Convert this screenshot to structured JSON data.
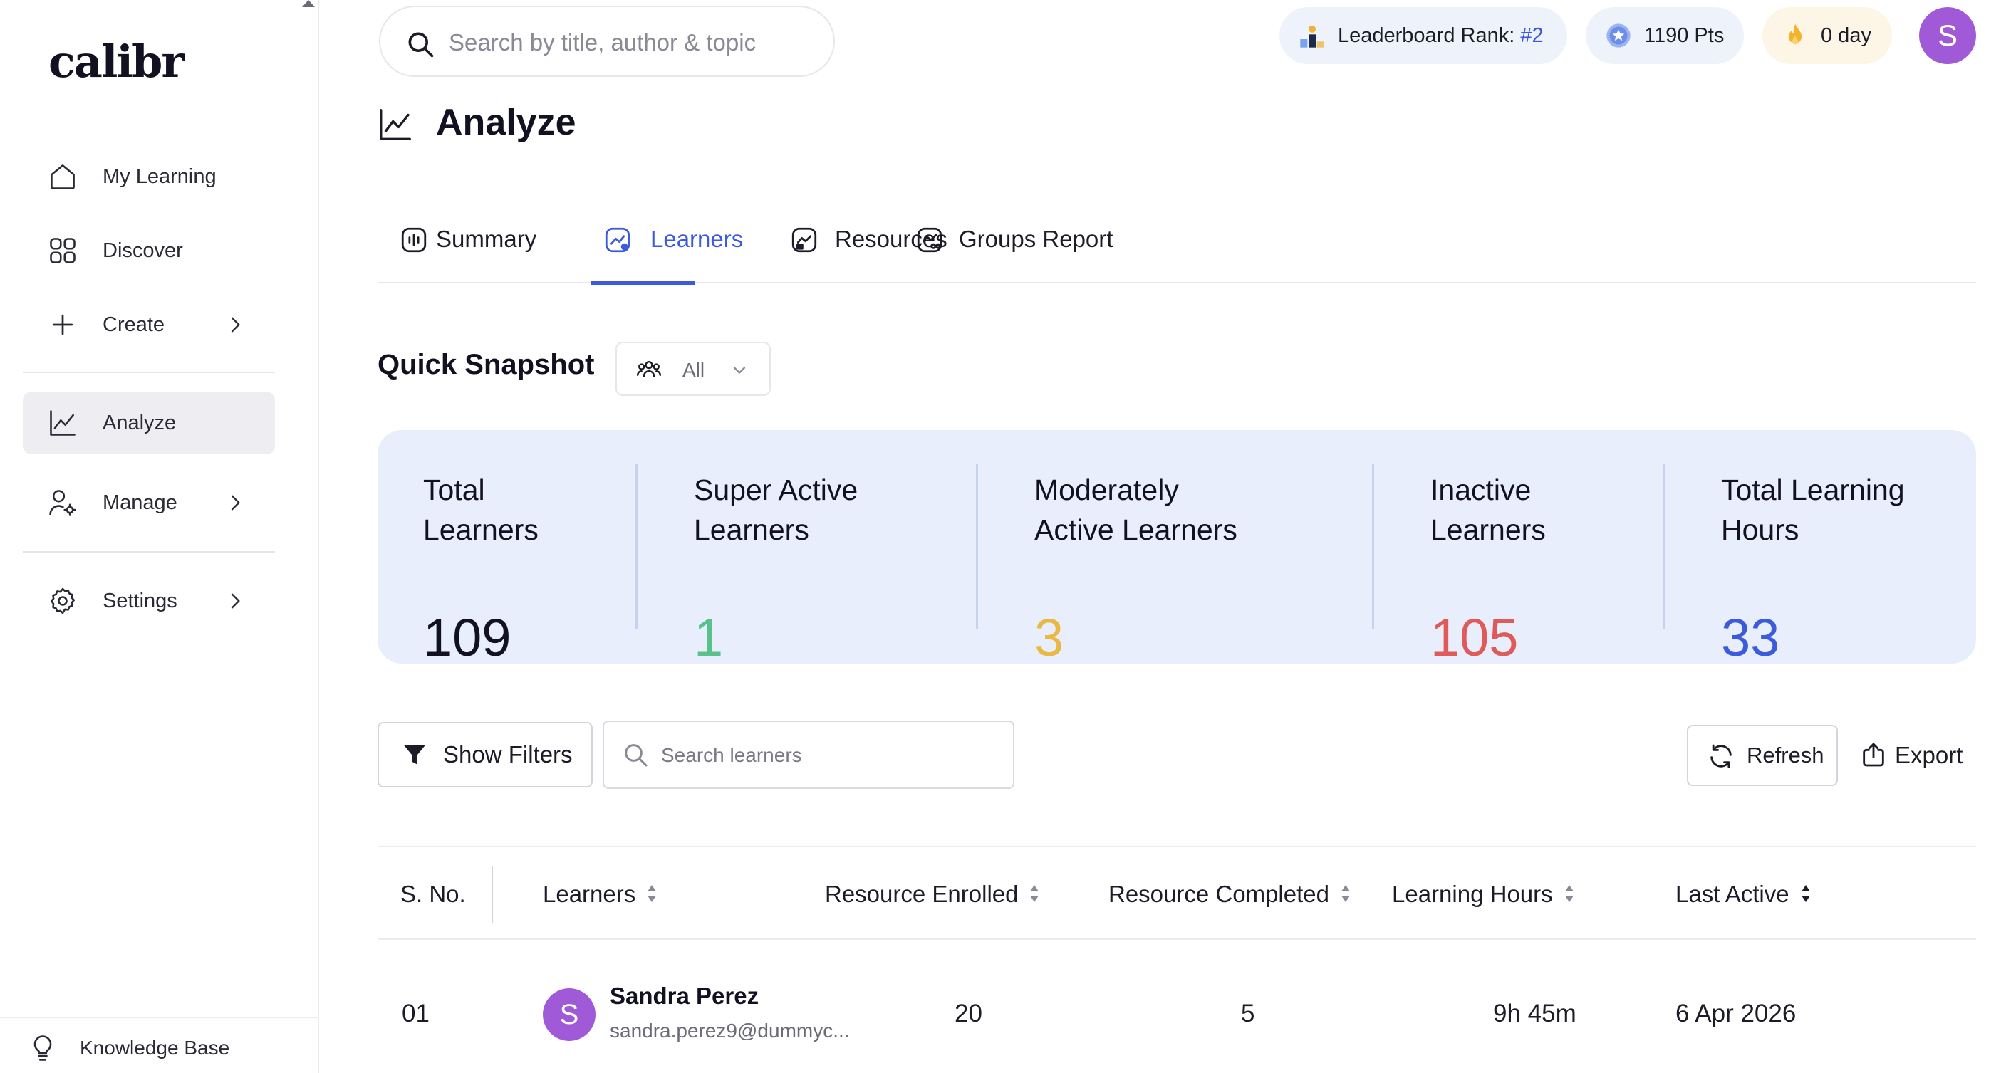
{
  "brand": {
    "logo": "calibr"
  },
  "sidebar": {
    "items": [
      {
        "label": "My Learning",
        "icon": "home-icon"
      },
      {
        "label": "Discover",
        "icon": "grid-icon"
      },
      {
        "label": "Create",
        "icon": "plus-icon",
        "has_submenu": true
      },
      {
        "label": "Analyze",
        "icon": "chart-line-icon",
        "active": true
      },
      {
        "label": "Manage",
        "icon": "user-gear-icon",
        "has_submenu": true
      },
      {
        "label": "Settings",
        "icon": "gear-icon",
        "has_submenu": true
      }
    ],
    "footer": {
      "label": "Knowledge Base",
      "icon": "lightbulb-icon"
    }
  },
  "topbar": {
    "search_placeholder": "Search by title, author & topic",
    "leaderboard_label": "Leaderboard Rank:",
    "leaderboard_rank": "#2",
    "points": "1190 Pts",
    "streak": "0 day",
    "avatar_initial": "S"
  },
  "page": {
    "title": "Analyze"
  },
  "tabs": [
    {
      "label": "Summary",
      "icon": "summary-icon"
    },
    {
      "label": "Learners",
      "icon": "learners-chart-icon",
      "active": true
    },
    {
      "label": "Resources",
      "icon": "resources-chart-icon"
    },
    {
      "label": "Groups Report",
      "icon": "groups-chart-icon"
    }
  ],
  "snapshot": {
    "title": "Quick Snapshot",
    "filter_value": "All",
    "stats": [
      {
        "label_line1": "Total",
        "label_line2": "Learners",
        "value": "109",
        "color": "#111122"
      },
      {
        "label_line1": "Super Active",
        "label_line2": "Learners",
        "value": "1",
        "color": "#58c28a"
      },
      {
        "label_line1": "Moderately",
        "label_line2": "Active Learners",
        "value": "3",
        "color": "#e9b944"
      },
      {
        "label_line1": "Inactive",
        "label_line2": "Learners",
        "value": "105",
        "color": "#e05a5a"
      },
      {
        "label_line1": "Total Learning",
        "label_line2": "Hours",
        "value": "33",
        "color": "#3b5bdb"
      }
    ]
  },
  "toolbar": {
    "filters_label": "Show Filters",
    "search_placeholder": "Search learners",
    "refresh_label": "Refresh",
    "export_label": "Export"
  },
  "table": {
    "columns": [
      "S. No.",
      "Learners",
      "Resource Enrolled",
      "Resource Completed",
      "Learning Hours",
      "Last Active"
    ],
    "rows": [
      {
        "sno": "01",
        "avatar_initial": "S",
        "name": "Sandra Perez",
        "email": "sandra.perez9@dummyc...",
        "enrolled": "20",
        "completed": "5",
        "hours": "9h 45m",
        "last_active": "6 Apr 2026"
      }
    ]
  },
  "colors": {
    "accent": "#3b5bdb",
    "avatar": "#a05ad8",
    "snapshot_bg": "#e8eefb"
  }
}
